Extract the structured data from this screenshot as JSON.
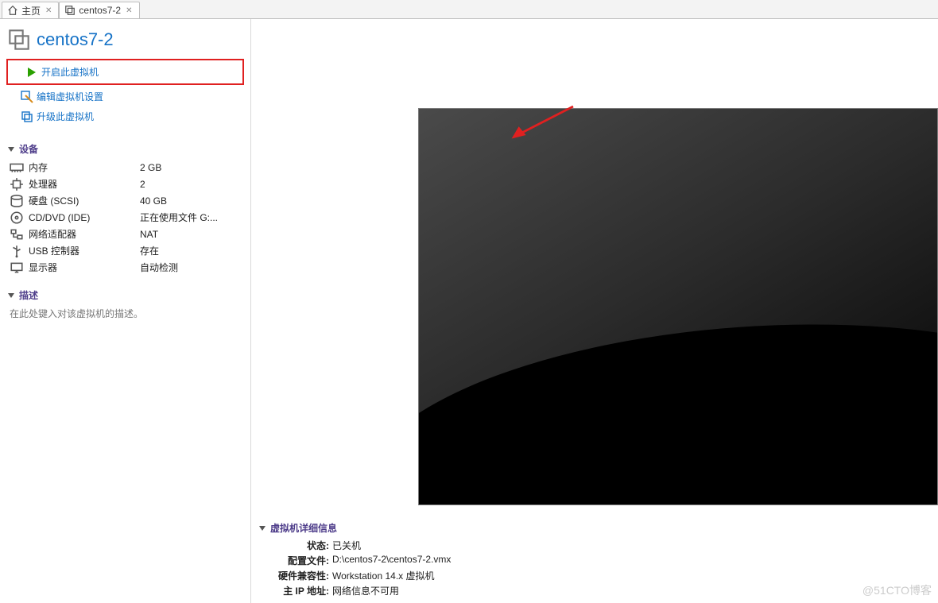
{
  "tabs": [
    {
      "label": "主页"
    },
    {
      "label": "centos7-2"
    }
  ],
  "vm": {
    "title": "centos7-2"
  },
  "actions": {
    "power_on": "开启此虚拟机",
    "edit_settings": "编辑虚拟机设置",
    "upgrade": "升级此虚拟机"
  },
  "sections": {
    "devices": "设备",
    "description": "描述",
    "details": "虚拟机详细信息"
  },
  "devices": [
    {
      "icon": "memory",
      "label": "内存",
      "value": "2 GB"
    },
    {
      "icon": "cpu",
      "label": "处理器",
      "value": "2"
    },
    {
      "icon": "disk",
      "label": "硬盘 (SCSI)",
      "value": "40 GB"
    },
    {
      "icon": "cd",
      "label": "CD/DVD (IDE)",
      "value": "正在使用文件 G:..."
    },
    {
      "icon": "net",
      "label": "网络适配器",
      "value": "NAT"
    },
    {
      "icon": "usb",
      "label": "USB 控制器",
      "value": "存在"
    },
    {
      "icon": "display",
      "label": "显示器",
      "value": "自动检测"
    }
  ],
  "description_placeholder": "在此处键入对该虚拟机的描述。",
  "details": {
    "state_k": "状态:",
    "state_v": "已关机",
    "config_k": "配置文件:",
    "config_v": "D:\\centos7-2\\centos7-2.vmx",
    "compat_k": "硬件兼容性:",
    "compat_v": "Workstation 14.x 虚拟机",
    "ip_k": "主 IP 地址:",
    "ip_v": "网络信息不可用"
  },
  "watermark": "@51CTO博客"
}
